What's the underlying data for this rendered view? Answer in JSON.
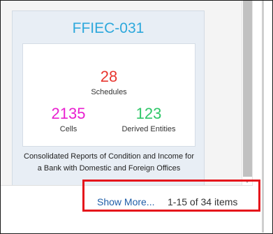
{
  "card": {
    "title": "FFIEC-031",
    "schedules": {
      "value": "28",
      "label": "Schedules"
    },
    "cells": {
      "value": "2135",
      "label": "Cells"
    },
    "derived_entities": {
      "value": "123",
      "label": "Derived Entities"
    },
    "description": "Consolidated Reports of Condition and Income for a Bank with Domestic and Foreign Offices"
  },
  "pager": {
    "show_more_label": "Show More...",
    "range_text": "1-15 of 34 items"
  },
  "colors": {
    "title": "#2da8dc",
    "schedules": "#e8362f",
    "cells": "#e91fd0",
    "derived_entities": "#2fc768",
    "link": "#1f5ea8",
    "highlight": "#e5141b"
  }
}
